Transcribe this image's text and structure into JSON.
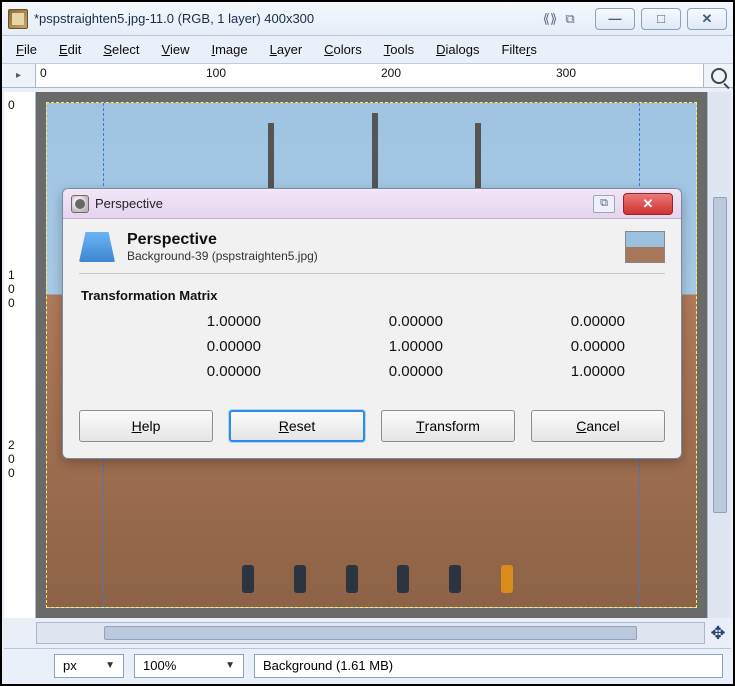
{
  "window": {
    "title": "*pspstraighten5.jpg-11.0 (RGB, 1 layer) 400x300",
    "minimize": "—",
    "maximize": "□",
    "close": "✕"
  },
  "menu": {
    "file": "File",
    "edit": "Edit",
    "select": "Select",
    "view": "View",
    "image": "Image",
    "layer": "Layer",
    "colors": "Colors",
    "tools": "Tools",
    "dialogs": "Dialogs",
    "filters": "Filters"
  },
  "ruler": {
    "h0": "0",
    "h100": "100",
    "h200": "200",
    "h300": "300",
    "v0": "0",
    "v100": "1\n0\n0",
    "v200": "2\n0\n0"
  },
  "status": {
    "unit": "px",
    "zoom": "100%",
    "layer": "Background (1.61 MB)"
  },
  "dialog": {
    "title": "Perspective",
    "heading": "Perspective",
    "subtitle": "Background-39 (pspstraighten5.jpg)",
    "section": "Transformation Matrix",
    "matrix": {
      "m00": "1.00000",
      "m01": "0.00000",
      "m02": "0.00000",
      "m10": "0.00000",
      "m11": "1.00000",
      "m12": "0.00000",
      "m20": "0.00000",
      "m21": "0.00000",
      "m22": "1.00000"
    },
    "buttons": {
      "help": "Help",
      "reset": "Reset",
      "transform": "Transform",
      "cancel": "Cancel"
    },
    "close": "✕"
  }
}
